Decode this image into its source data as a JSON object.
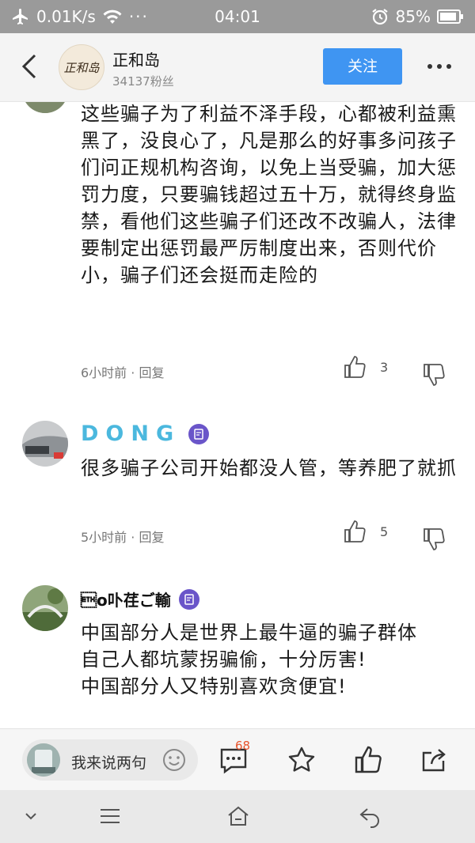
{
  "status_bar": {
    "network_speed": "0.01K/s",
    "time": "04:01",
    "battery": "85%"
  },
  "header": {
    "title": "正和岛",
    "followers": "34137粉丝",
    "follow_label": "关注",
    "avatar_text": "正和岛"
  },
  "comments": [
    {
      "text": "这些骗子为了利益不泽手段，心都被利益熏黑了，没良心了，凡是那么的好事多问孩子们问正规机构咨询，以免上当受骗，加大惩罚力度，只要骗钱超过五十万，就得终身监禁，看他们这些骗子们还改不改骗人，法律要制定出惩罚最严厉制度出来，否则代价小，骗子们还会挺而走险的",
      "time": "6小时前",
      "reply": "回复",
      "likes": "3"
    },
    {
      "name": "DONG",
      "text": "很多骗子公司开始都没人管，等养肥了就抓",
      "time": "5小时前",
      "reply": "回复",
      "likes": "5"
    },
    {
      "name": "\u0003o卟荏ご輸",
      "text_lines": [
        "中国部分人是世界上最牛逼的骗子群体",
        "自己人都坑蒙拐骗偷，十分厉害!",
        "中国部分人又特别喜欢贪便宜!"
      ]
    }
  ],
  "bottom_bar": {
    "input_placeholder": "我来说两句",
    "comment_count": "68"
  },
  "icons": {
    "back": "chevron-left-icon",
    "more": "more-dots-icon",
    "like": "thumbs-up-icon",
    "dislike": "thumbs-down-icon",
    "star": "star-icon",
    "share": "share-icon"
  },
  "colors": {
    "accent": "#3f95f2",
    "dong_name": "#4bb8de",
    "badge": "#6a55c9",
    "count": "#e8542c"
  }
}
